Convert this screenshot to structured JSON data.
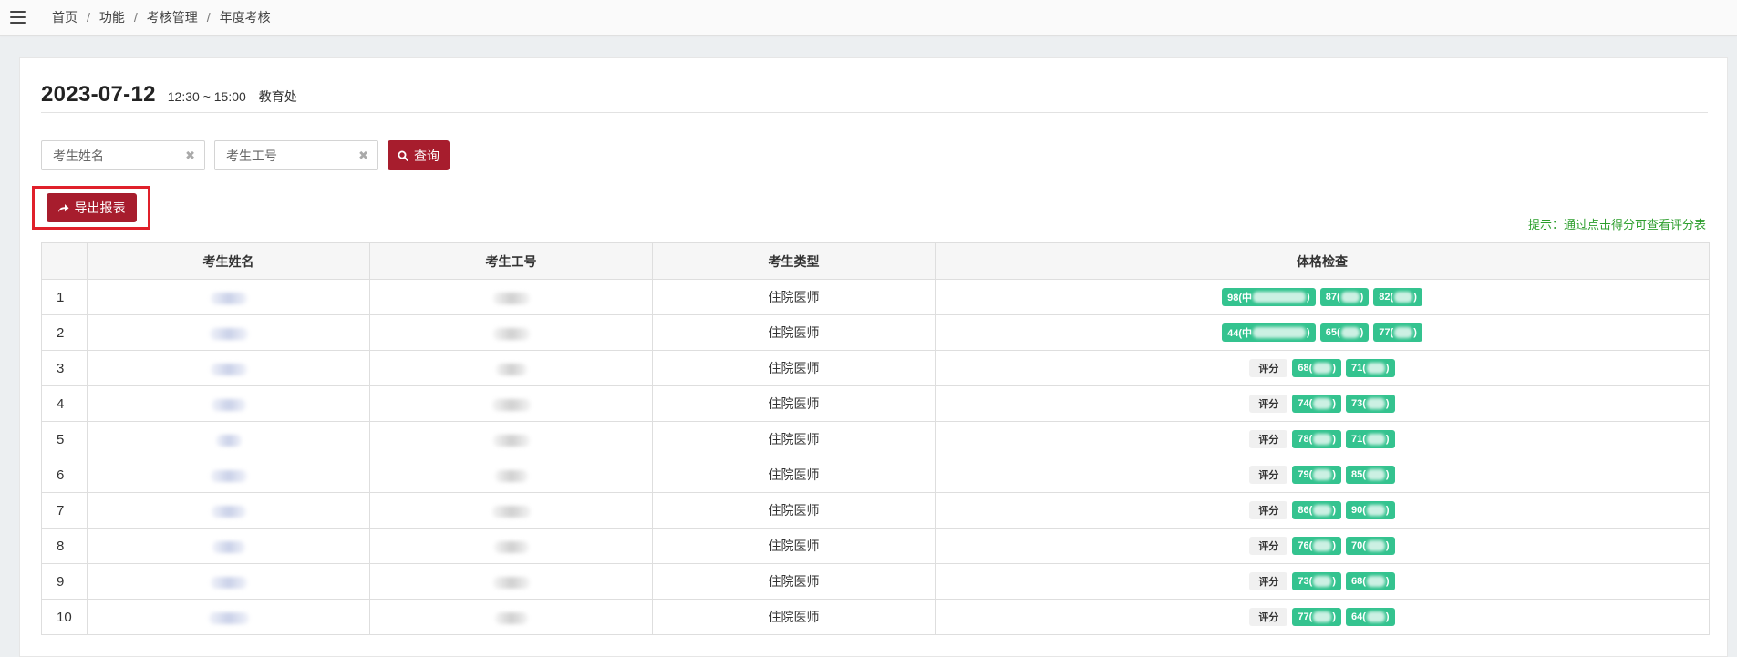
{
  "breadcrumb": [
    "首页",
    "功能",
    "考核管理",
    "年度考核"
  ],
  "header": {
    "date": "2023-07-12",
    "time": "12:30 ~ 15:00",
    "dept": "教育处"
  },
  "search": {
    "name_placeholder": "考生姓名",
    "id_placeholder": "考生工号",
    "query_label": "查询",
    "clear_glyph": "✖"
  },
  "export_label": "导出报表",
  "hint": "提示：通过点击得分可查看评分表",
  "table": {
    "columns": [
      "",
      "考生姓名",
      "考生工号",
      "考生类型",
      "体格检查"
    ],
    "rows": [
      {
        "idx": "1",
        "type": "住院医师",
        "grade": "",
        "scores": [
          "98(中",
          "87(",
          "82("
        ]
      },
      {
        "idx": "2",
        "type": "住院医师",
        "grade": "",
        "scores": [
          "44(中",
          "65(",
          "77("
        ]
      },
      {
        "idx": "3",
        "type": "住院医师",
        "grade": "评分",
        "scores": [
          "68(",
          "71("
        ]
      },
      {
        "idx": "4",
        "type": "住院医师",
        "grade": "评分",
        "scores": [
          "74(",
          "73("
        ]
      },
      {
        "idx": "5",
        "type": "住院医师",
        "grade": "评分",
        "scores": [
          "78(",
          "71("
        ]
      },
      {
        "idx": "6",
        "type": "住院医师",
        "grade": "评分",
        "scores": [
          "79(",
          "85("
        ]
      },
      {
        "idx": "7",
        "type": "住院医师",
        "grade": "评分",
        "scores": [
          "86(",
          "90("
        ]
      },
      {
        "idx": "8",
        "type": "住院医师",
        "grade": "评分",
        "scores": [
          "76(",
          "70("
        ]
      },
      {
        "idx": "9",
        "type": "住院医师",
        "grade": "评分",
        "scores": [
          "73(",
          "68("
        ]
      },
      {
        "idx": "10",
        "type": "住院医师",
        "grade": "评分",
        "scores": [
          "77(",
          "64("
        ]
      }
    ]
  },
  "colors": {
    "accent": "#a71d2d",
    "chip": "#34c38f",
    "hint": "#2c9e2c",
    "highlight": "#e0202a"
  }
}
